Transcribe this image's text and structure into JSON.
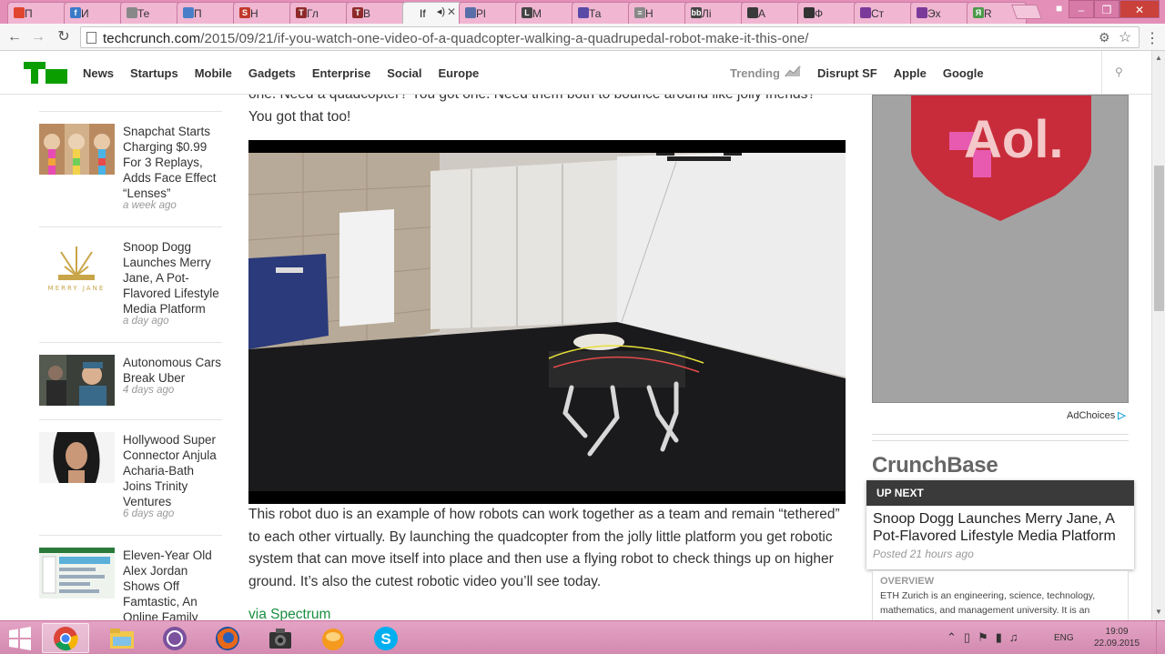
{
  "browser": {
    "tabs": [
      {
        "title": "П",
        "fav_color": "#e0452f",
        "fav_glyph": ""
      },
      {
        "title": "И",
        "fav_color": "#3a7bc8",
        "fav_glyph": "f"
      },
      {
        "title": "Те",
        "fav_color": "#888888",
        "fav_glyph": ""
      },
      {
        "title": "П",
        "fav_color": "#4a7fc8",
        "fav_glyph": ""
      },
      {
        "title": "Н",
        "fav_color": "#c0392b",
        "fav_glyph": "S"
      },
      {
        "title": "Гл",
        "fav_color": "#8e2a2a",
        "fav_glyph": "T"
      },
      {
        "title": "В",
        "fav_color": "#8e2a2a",
        "fav_glyph": "T"
      },
      {
        "title": "If",
        "fav_color": "#f6f6f6",
        "fav_glyph": ""
      },
      {
        "title": "Pl",
        "fav_color": "#5a6ea8",
        "fav_glyph": ""
      },
      {
        "title": "М",
        "fav_color": "#444444",
        "fav_glyph": "L"
      },
      {
        "title": "Та",
        "fav_color": "#5a4aa8",
        "fav_glyph": ""
      },
      {
        "title": "Н",
        "fav_color": "#888888",
        "fav_glyph": "≡"
      },
      {
        "title": "Лі",
        "fav_color": "#444444",
        "fav_glyph": "bb"
      },
      {
        "title": "А",
        "fav_color": "#3a3a3a",
        "fav_glyph": ""
      },
      {
        "title": "Ф",
        "fav_color": "#333333",
        "fav_glyph": ""
      },
      {
        "title": "Ст",
        "fav_color": "#7a3a9a",
        "fav_glyph": ""
      },
      {
        "title": "Эх",
        "fav_color": "#7a3a9a",
        "fav_glyph": ""
      },
      {
        "title": "R",
        "fav_color": "#4a9a4a",
        "fav_glyph": "Я"
      }
    ],
    "url_host": "techcrunch.com",
    "url_path": "/2015/09/21/if-you-watch-one-video-of-a-quadcopter-walking-a-quadrupedal-robot-make-it-this-one/"
  },
  "nav": {
    "links": [
      "News",
      "Startups",
      "Mobile",
      "Gadgets",
      "Enterprise",
      "Social",
      "Europe"
    ],
    "trending_label": "Trending",
    "right_links": [
      "Disrupt SF",
      "Apple",
      "Google"
    ]
  },
  "sidebar": {
    "items": [
      {
        "title": "Snapchat Starts Charging $0.99 For 3 Replays, Adds Face Effect “Lenses”",
        "date": "a week ago",
        "thumb": "snapchat"
      },
      {
        "title": "Snoop Dogg Launches Merry Jane, A Pot-Flavored Lifestyle Media Platform",
        "date": "a day ago",
        "thumb": "merryjane"
      },
      {
        "title": "Autonomous Cars Break Uber",
        "date": "4 days ago",
        "thumb": "cars"
      },
      {
        "title": "Hollywood Super Connector Anjula Acharia-Bath Joins Trinity Ventures",
        "date": "6 days ago",
        "thumb": "anjula"
      },
      {
        "title": "Eleven-Year Old Alex Jordan Shows Off Famtastic, An Online Family",
        "date": "",
        "thumb": "famtastic"
      }
    ],
    "merry_jane_logo_text": "MERRY JANE"
  },
  "article": {
    "intro_text": "one. Need a quadcopter? You got one. Need them both to bounce around like jolly friends? You got that too!",
    "body_text": "This robot duo is an example of how robots can work together as a team and remain “tethered” to each other virtually. By launching the quadcopter from the jolly little platform you get robotic system that can move itself into place and then use a flying robot to check things up on higher ground. It’s also the cutest robotic video you’ll see today.",
    "via_text": "via Spectrum"
  },
  "rail": {
    "ad_logo": "Aol.",
    "adchoices_label": "AdChoices",
    "crunchbase_title": "CrunchBase",
    "upnext_label": "UP NEXT",
    "upnext_title": "Snoop Dogg Launches Merry Jane, A Pot-Flavored Lifestyle Media Platform",
    "upnext_date": "Posted 21 hours ago",
    "overview_label": "OVERVIEW",
    "overview_text": "ETH Zurich is an engineering, science, technology, mathematics, and management university. It is an"
  },
  "taskbar": {
    "apps": [
      "chrome",
      "explorer",
      "viber",
      "firefox",
      "camera",
      "orange-app",
      "skype"
    ],
    "lang": "ENG",
    "time": "19:09",
    "date": "22.09.2015"
  },
  "colors": {
    "tc_green": "#0a9e01",
    "link_green": "#1a8d3f",
    "tab_strip": "#e38fb8"
  }
}
